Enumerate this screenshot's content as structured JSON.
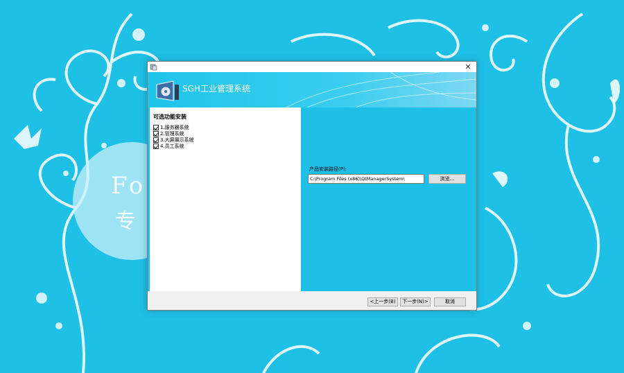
{
  "background": {
    "text_line_1": "Fo",
    "text_line_2": "专",
    "color": "#1fc0e6"
  },
  "installer": {
    "close_symbol": "✕",
    "banner_title": "SGH工业管理系统",
    "features_title": "可选功能安装",
    "features": [
      {
        "label": "1.服务器系统",
        "checked": true
      },
      {
        "label": "2.管理系统",
        "checked": true
      },
      {
        "label": "3.大屏展示系统",
        "checked": true
      },
      {
        "label": "4.员工系统",
        "checked": true
      }
    ],
    "path_label": "产品安装路径(P):",
    "path_value": "C:\\Program Files (x86)\\QtManagerSystem\\",
    "browse_label": "浏览...",
    "back_label": "<上一步(B)",
    "next_label": "下一步(N)>",
    "cancel_label": "取消"
  }
}
